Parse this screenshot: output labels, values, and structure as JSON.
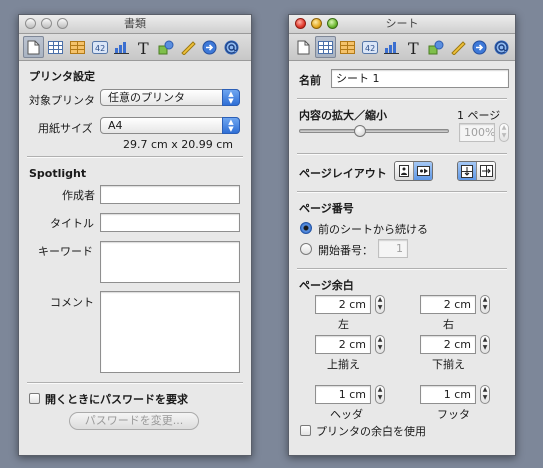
{
  "window_left": {
    "title": "書類",
    "printer_section": {
      "header": "プリンタ設定",
      "printer_label": "対象プリンタ",
      "printer_value": "任意のプリンタ",
      "paper_label": "用紙サイズ",
      "paper_value": "A4",
      "paper_dimensions": "29.7 cm x 20.99 cm"
    },
    "spotlight_section": {
      "header": "Spotlight",
      "author_label": "作成者",
      "author_value": "",
      "title_label": "タイトル",
      "title_value": "",
      "keywords_label": "キーワード",
      "keywords_value": "",
      "comments_label": "コメント",
      "comments_value": ""
    },
    "password_checkbox_label": "開くときにパスワードを要求",
    "password_checkbox_checked": false,
    "change_password_button": "パスワードを変更..."
  },
  "window_right": {
    "title": "シート",
    "name_label": "名前",
    "name_value": "シート 1",
    "scale_header": "内容の拡大／縮小",
    "page_count": "1 ページ",
    "scale_value": "100%",
    "scale_fraction": 0.4,
    "layout_header": "ページレイアウト",
    "page_numbers_header": "ページ番号",
    "continue_option": "前のシートから続ける",
    "start_at_option": "開始番号：",
    "start_at_value": "1",
    "margins_header": "ページ余白",
    "margin_left_value": "2 cm",
    "margin_left_label": "左",
    "margin_right_value": "2 cm",
    "margin_right_label": "右",
    "margin_top_value": "2 cm",
    "margin_top_label": "上揃え",
    "margin_bottom_value": "2 cm",
    "margin_bottom_label": "下揃え",
    "header_margin_value": "1 cm",
    "header_margin_label": "ヘッダ",
    "footer_margin_value": "1 cm",
    "footer_margin_label": "フッタ",
    "use_printer_margins_label": "プリンタの余白を使用",
    "use_printer_margins_checked": false
  },
  "toolbar_icons": [
    "document-icon",
    "table-icon",
    "cell-format-icon",
    "number-format-icon",
    "chart-icon",
    "text-icon",
    "shapes-icon",
    "ruler-icon",
    "link-icon",
    "at-icon"
  ],
  "colors": {
    "desktop": "#7d8799",
    "accent_blue": "#2f6fd6",
    "window_bg": "#e8e8e8"
  }
}
